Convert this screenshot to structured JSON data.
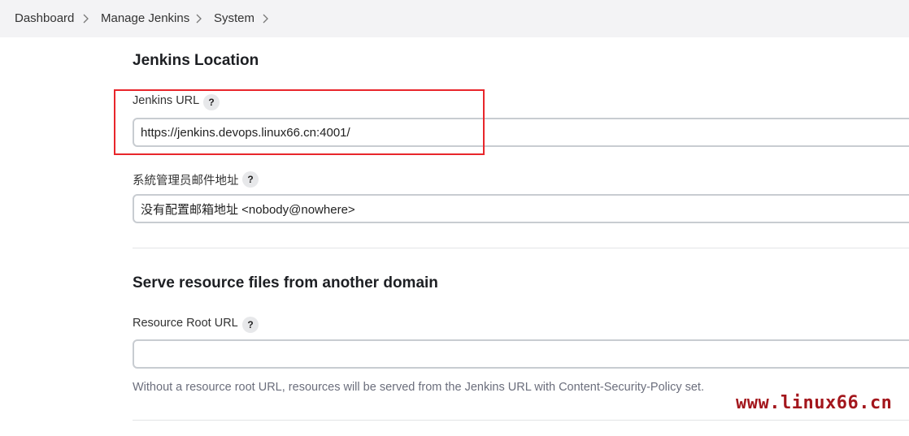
{
  "breadcrumb": {
    "items": [
      "Dashboard",
      "Manage Jenkins",
      "System"
    ]
  },
  "location": {
    "title": "Jenkins Location",
    "url_label": "Jenkins URL",
    "url_value": "https://jenkins.devops.linux66.cn:4001/",
    "email_label": "系統管理员邮件地址",
    "email_value": "没有配置邮箱地址 <nobody@nowhere>",
    "help_glyph": "?"
  },
  "resource": {
    "title": "Serve resource files from another domain",
    "root_label": "Resource Root URL",
    "root_value": "",
    "hint": "Without a resource root URL, resources will be served from the Jenkins URL with Content-Security-Policy set."
  },
  "watermark": "www.linux66.cn",
  "colors": {
    "highlight": "#e8262b",
    "watermark": "#a3161c",
    "breadcrumb_bg": "#f3f3f5"
  }
}
